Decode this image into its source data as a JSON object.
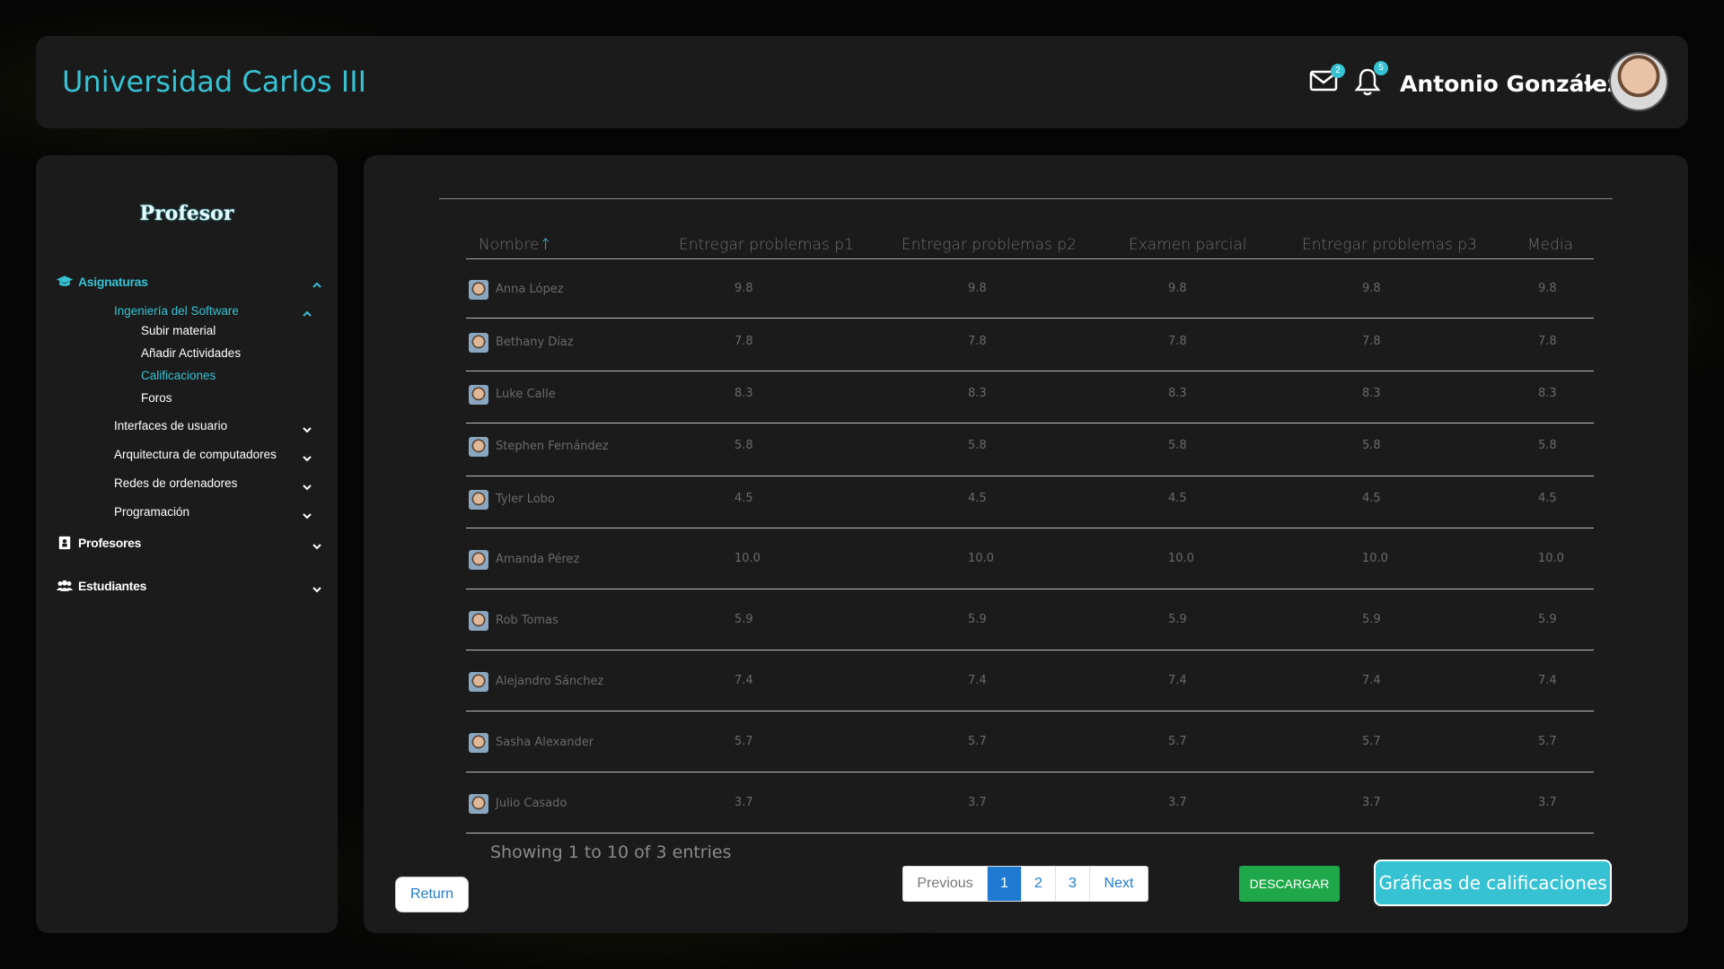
{
  "header": {
    "brand": "Universidad Carlos III",
    "mail_count": "2",
    "bell_count": "5",
    "user_name": "Antonio González"
  },
  "sidebar": {
    "title": "Profesor",
    "asignaturas_label": "Asignaturas",
    "subject_active": "Ingeniería del Software",
    "sub_items": [
      "Subir material",
      "Añadir Actividades",
      "Calificaciones",
      "Foros"
    ],
    "subjects": [
      "Interfaces de usuario",
      "Arquitectura de computadores",
      "Redes de ordenadores",
      "Programación"
    ],
    "profesores_label": "Profesores",
    "estudiantes_label": "Estudiantes"
  },
  "table": {
    "columns": [
      "Nombre",
      "Entregar problemas p1",
      "Entregar problemas p2",
      "Examen parcial",
      "Entregar problemas p3",
      "Media"
    ],
    "sort_arrow": "↑",
    "rows": [
      {
        "name": "Anna López",
        "p1": "9.8",
        "p2": "9.8",
        "exam": "9.8",
        "p3": "9.8",
        "media": "9.8"
      },
      {
        "name": "Bethany Díaz",
        "p1": "7.8",
        "p2": "7.8",
        "exam": "7.8",
        "p3": "7.8",
        "media": "7.8"
      },
      {
        "name": "Luke Calle",
        "p1": "8.3",
        "p2": "8.3",
        "exam": "8.3",
        "p3": "8.3",
        "media": "8.3"
      },
      {
        "name": "Stephen Fernández",
        "p1": "5.8",
        "p2": "5.8",
        "exam": "5.8",
        "p3": "5.8",
        "media": "5.8"
      },
      {
        "name": "Tyler Lobo",
        "p1": "4.5",
        "p2": "4.5",
        "exam": "4.5",
        "p3": "4.5",
        "media": "4.5"
      },
      {
        "name": "Amanda Pérez",
        "p1": "10.0",
        "p2": "10.0",
        "exam": "10.0",
        "p3": "10.0",
        "media": "10.0"
      },
      {
        "name": "Rob Tomas",
        "p1": "5.9",
        "p2": "5.9",
        "exam": "5.9",
        "p3": "5.9",
        "media": "5.9"
      },
      {
        "name": "Alejandro Sánchez",
        "p1": "7.4",
        "p2": "7.4",
        "exam": "7.4",
        "p3": "7.4",
        "media": "7.4"
      },
      {
        "name": "Sasha Alexander",
        "p1": "5.7",
        "p2": "5.7",
        "exam": "5.7",
        "p3": "5.7",
        "media": "5.7"
      },
      {
        "name": "Julio Casado",
        "p1": "3.7",
        "p2": "3.7",
        "exam": "3.7",
        "p3": "3.7",
        "media": "3.7"
      }
    ],
    "info": "Showing 1 to 10 of 3 entries"
  },
  "footer": {
    "return_label": "Return",
    "pager": {
      "prev": "Previous",
      "pages": [
        "1",
        "2",
        "3"
      ],
      "next": "Next"
    },
    "download_label": "DESCARGAR",
    "graphs_label": "Gráficas de calificaciones"
  }
}
